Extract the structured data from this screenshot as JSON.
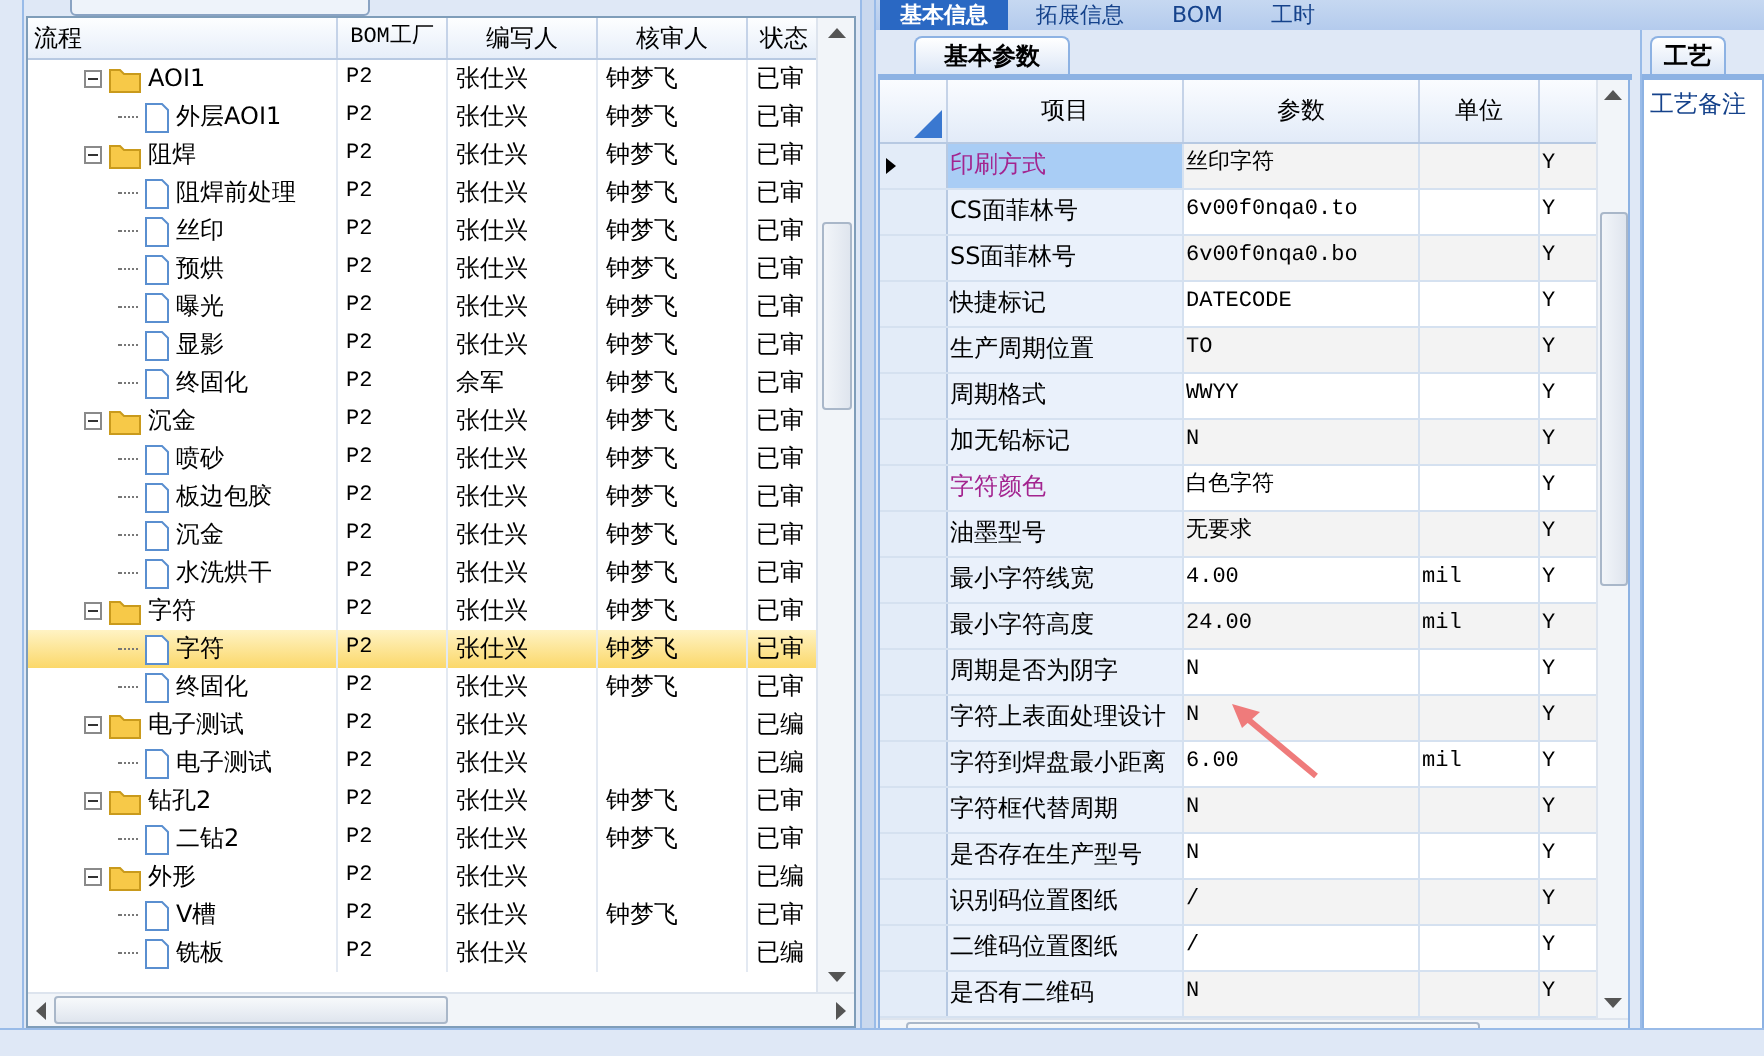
{
  "tree": {
    "columns": [
      "流程",
      "BOM工厂",
      "编写人",
      "核审人",
      "状态"
    ],
    "rows": [
      {
        "kind": "folder",
        "name": "AOI1",
        "bom": "P2",
        "author": "张仕兴",
        "reviewer": "钟梦飞",
        "status": "已审",
        "expanded": true,
        "selected": false,
        "children": [
          {
            "kind": "file",
            "name": "外层AOI1",
            "bom": "P2",
            "author": "张仕兴",
            "reviewer": "钟梦飞",
            "status": "已审",
            "selected": false
          }
        ]
      },
      {
        "kind": "folder",
        "name": "阻焊",
        "bom": "P2",
        "author": "张仕兴",
        "reviewer": "钟梦飞",
        "status": "已审",
        "expanded": true,
        "selected": false,
        "children": [
          {
            "kind": "file",
            "name": "阻焊前处理",
            "bom": "P2",
            "author": "张仕兴",
            "reviewer": "钟梦飞",
            "status": "已审",
            "selected": false
          },
          {
            "kind": "file",
            "name": "丝印",
            "bom": "P2",
            "author": "张仕兴",
            "reviewer": "钟梦飞",
            "status": "已审",
            "selected": false
          },
          {
            "kind": "file",
            "name": "预烘",
            "bom": "P2",
            "author": "张仕兴",
            "reviewer": "钟梦飞",
            "status": "已审",
            "selected": false
          },
          {
            "kind": "file",
            "name": "曝光",
            "bom": "P2",
            "author": "张仕兴",
            "reviewer": "钟梦飞",
            "status": "已审",
            "selected": false
          },
          {
            "kind": "file",
            "name": "显影",
            "bom": "P2",
            "author": "张仕兴",
            "reviewer": "钟梦飞",
            "status": "已审",
            "selected": false
          },
          {
            "kind": "file",
            "name": "终固化",
            "bom": "P2",
            "author": "佘军",
            "reviewer": "钟梦飞",
            "status": "已审",
            "selected": false
          }
        ]
      },
      {
        "kind": "folder",
        "name": "沉金",
        "bom": "P2",
        "author": "张仕兴",
        "reviewer": "钟梦飞",
        "status": "已审",
        "expanded": true,
        "selected": false,
        "children": [
          {
            "kind": "file",
            "name": "喷砂",
            "bom": "P2",
            "author": "张仕兴",
            "reviewer": "钟梦飞",
            "status": "已审",
            "selected": false
          },
          {
            "kind": "file",
            "name": "板边包胶",
            "bom": "P2",
            "author": "张仕兴",
            "reviewer": "钟梦飞",
            "status": "已审",
            "selected": false
          },
          {
            "kind": "file",
            "name": "沉金",
            "bom": "P2",
            "author": "张仕兴",
            "reviewer": "钟梦飞",
            "status": "已审",
            "selected": false
          },
          {
            "kind": "file",
            "name": "水洗烘干",
            "bom": "P2",
            "author": "张仕兴",
            "reviewer": "钟梦飞",
            "status": "已审",
            "selected": false
          }
        ]
      },
      {
        "kind": "folder",
        "name": "字符",
        "bom": "P2",
        "author": "张仕兴",
        "reviewer": "钟梦飞",
        "status": "已审",
        "expanded": true,
        "selected": false,
        "children": [
          {
            "kind": "file",
            "name": "字符",
            "bom": "P2",
            "author": "张仕兴",
            "reviewer": "钟梦飞",
            "status": "已审",
            "selected": true
          },
          {
            "kind": "file",
            "name": "终固化",
            "bom": "P2",
            "author": "张仕兴",
            "reviewer": "钟梦飞",
            "status": "已审",
            "selected": false
          }
        ]
      },
      {
        "kind": "folder",
        "name": "电子测试",
        "bom": "P2",
        "author": "张仕兴",
        "status": "已编",
        "expanded": true,
        "selected": false,
        "children": [
          {
            "kind": "file",
            "name": "电子测试",
            "bom": "P2",
            "author": "张仕兴",
            "status": "已编",
            "selected": false
          }
        ]
      },
      {
        "kind": "folder",
        "name": "钻孔2",
        "bom": "P2",
        "author": "张仕兴",
        "reviewer": "钟梦飞",
        "status": "已审",
        "expanded": true,
        "selected": false,
        "children": [
          {
            "kind": "file",
            "name": "二钻2",
            "bom": "P2",
            "author": "张仕兴",
            "reviewer": "钟梦飞",
            "status": "已审",
            "selected": false
          }
        ]
      },
      {
        "kind": "folder",
        "name": "外形",
        "bom": "P2",
        "author": "张仕兴",
        "status": "已编",
        "expanded": true,
        "selected": false,
        "children": [
          {
            "kind": "file",
            "name": "V槽",
            "bom": "P2",
            "author": "张仕兴",
            "reviewer": "钟梦飞",
            "status": "已审",
            "selected": false
          },
          {
            "kind": "file",
            "name": "铣板",
            "bom": "P2",
            "author": "张仕兴",
            "status": "已编",
            "selected": false
          }
        ]
      }
    ]
  },
  "top_tabs": [
    {
      "label": "基本信息",
      "selected": true
    },
    {
      "label": "拓展信息",
      "selected": false
    },
    {
      "label": "BOM",
      "selected": false
    },
    {
      "label": "工时",
      "selected": false
    }
  ],
  "params": {
    "tab": "基本参数",
    "columns": [
      "项目",
      "参数",
      "单位"
    ],
    "rows": [
      {
        "item": "印刷方式",
        "value": "丝印字符",
        "col_4": "Y",
        "highlighted": true,
        "selected": true
      },
      {
        "item": "CS面菲林号",
        "value": "6v00f0nqa0.to",
        "col_4": "Y",
        "highlighted": false,
        "selected": false
      },
      {
        "item": "SS面菲林号",
        "value": "6v00f0nqa0.bo",
        "col_4": "Y",
        "highlighted": false,
        "selected": false
      },
      {
        "item": "快捷标记",
        "value": "DATECODE",
        "col_4": "Y",
        "highlighted": false,
        "selected": false
      },
      {
        "item": "生产周期位置",
        "value": "TO",
        "col_4": "Y",
        "highlighted": false,
        "selected": false
      },
      {
        "item": "周期格式",
        "value": "WWYY",
        "col_4": "Y",
        "highlighted": false,
        "selected": false
      },
      {
        "item": "加无铅标记",
        "value": "N",
        "col_4": "Y",
        "highlighted": false,
        "selected": false
      },
      {
        "item": "字符颜色",
        "value": "白色字符",
        "col_4": "Y",
        "highlighted": true,
        "selected": false
      },
      {
        "item": "油墨型号",
        "value": "无要求",
        "col_4": "Y",
        "highlighted": false,
        "selected": false
      },
      {
        "item": "最小字符线宽",
        "value": "4.00",
        "unit": "mil",
        "col_4": "Y",
        "highlighted": false,
        "selected": false
      },
      {
        "item": "最小字符高度",
        "value": "24.00",
        "unit": "mil",
        "col_4": "Y",
        "highlighted": false,
        "selected": false
      },
      {
        "item": "周期是否为阴字",
        "value": "N",
        "col_4": "Y",
        "highlighted": false,
        "selected": false
      },
      {
        "item": "字符上表面处理设计",
        "value": "N",
        "col_4": "Y",
        "highlighted": false,
        "selected": false
      },
      {
        "item": "字符到焊盘最小距离",
        "value": "6.00",
        "unit": "mil",
        "col_4": "Y",
        "highlighted": false,
        "selected": false
      },
      {
        "item": "字符框代替周期",
        "value": "N",
        "col_4": "Y",
        "highlighted": false,
        "selected": false
      },
      {
        "item": "是否存在生产型号",
        "value": "N",
        "col_4": "Y",
        "highlighted": false,
        "selected": false
      },
      {
        "item": "识别码位置图纸",
        "value": "/",
        "col_4": "Y",
        "highlighted": false,
        "selected": false
      },
      {
        "item": "二维码位置图纸",
        "value": "/",
        "col_4": "Y",
        "highlighted": false,
        "selected": false
      },
      {
        "item": "是否有二维码",
        "value": "N",
        "col_4": "Y",
        "highlighted": false,
        "selected": false
      }
    ]
  },
  "side_panel": {
    "tab": "工艺",
    "label": "工艺备注"
  }
}
